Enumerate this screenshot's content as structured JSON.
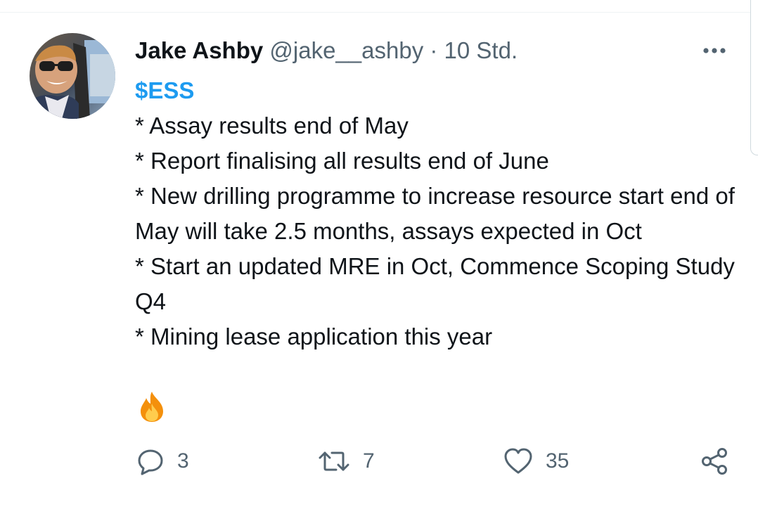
{
  "tweet": {
    "author_name": "Jake Ashby",
    "handle": "@jake__ashby",
    "separator": "·",
    "time": "10 Std.",
    "cashtag": "$ESS",
    "lines": [
      "* Assay results end of May",
      "* Report finalising all results end of June",
      "* New drilling programme to increase resource start end of May will take 2.5 months, assays expected in Oct",
      "* Start an updated MRE in Oct, Commence Scoping Study Q4",
      "* Mining lease application this year"
    ],
    "emoji": "fire-emoji"
  },
  "actions": {
    "reply_count": "3",
    "retweet_count": "7",
    "like_count": "35"
  },
  "icons": {
    "more": "more-icon",
    "reply": "reply-icon",
    "retweet": "retweet-icon",
    "like": "heart-icon",
    "share": "share-icon"
  },
  "colors": {
    "accent": "#1d9bf0",
    "text": "#0f1419",
    "secondary": "#536471"
  }
}
